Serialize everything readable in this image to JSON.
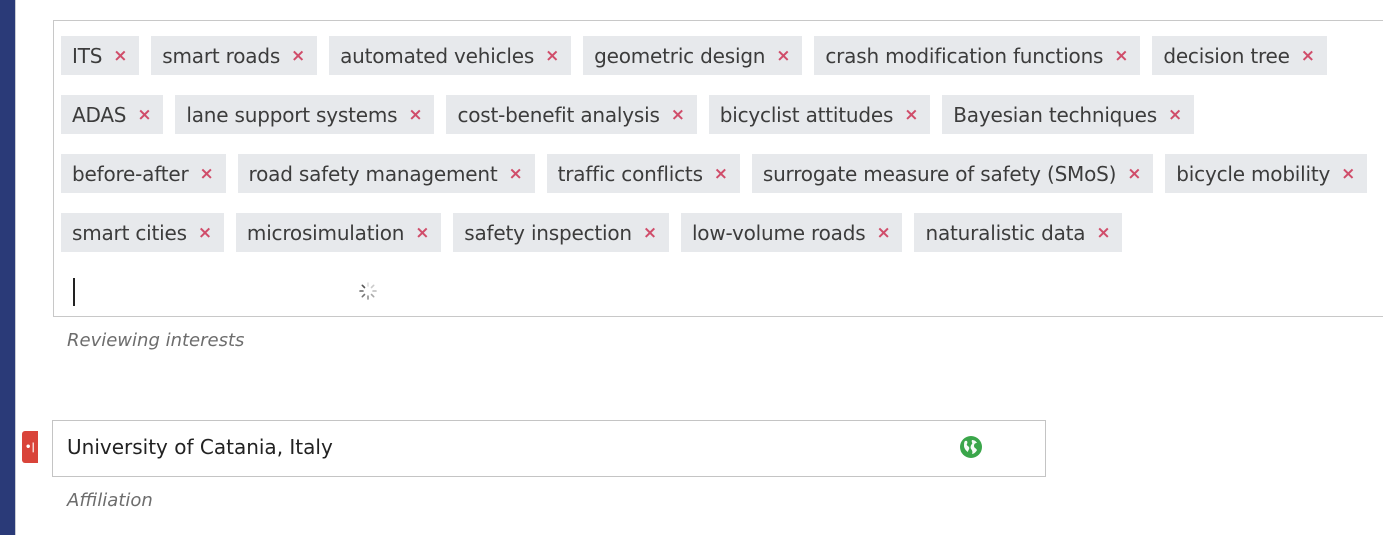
{
  "reviewing_interests": {
    "tags": [
      "ITS",
      "smart roads",
      "automated vehicles",
      "geometric design",
      "crash modification functions",
      "decision tree",
      "ADAS",
      "lane support systems",
      "cost-benefit analysis",
      "bicyclist attitudes",
      "Bayesian techniques",
      "before-after",
      "road safety management",
      "traffic conflicts",
      "surrogate measure of safety (SMoS)",
      "bicycle mobility",
      "smart cities",
      "microsimulation",
      "safety inspection",
      "low-volume roads",
      "naturalistic data"
    ],
    "remove_glyph": "×",
    "help": "Reviewing interests"
  },
  "affiliation": {
    "value": "University of Catania, Italy",
    "help": "Affiliation",
    "marker": "•|"
  },
  "icons": {
    "spinner": "loading-spinner-icon",
    "globe": "globe-icon",
    "globe_color": "#3aa64a"
  }
}
